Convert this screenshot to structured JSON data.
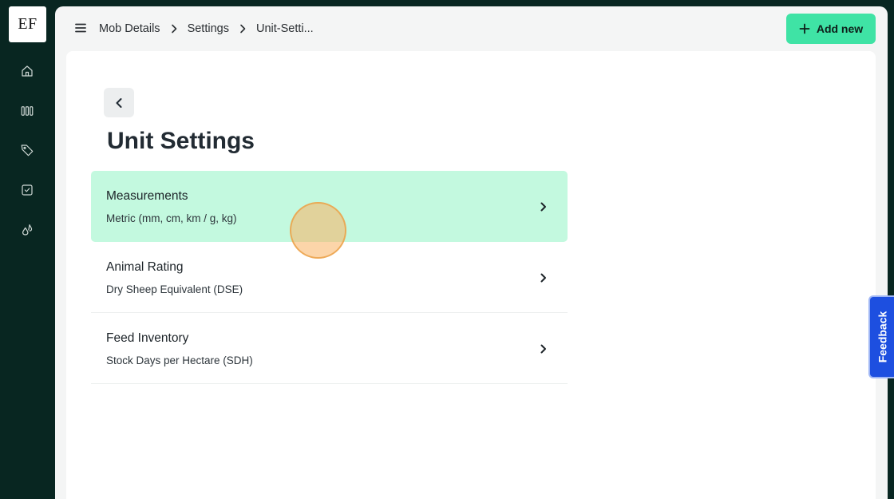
{
  "sidebar": {
    "logo_text": "EF",
    "items": [
      {
        "name": "home",
        "icon": "home-icon"
      },
      {
        "name": "paddocks",
        "icon": "columns-icon"
      },
      {
        "name": "tags",
        "icon": "tag-icon"
      },
      {
        "name": "tasks",
        "icon": "checkbox-icon"
      },
      {
        "name": "feed",
        "icon": "drops-icon"
      }
    ]
  },
  "header": {
    "breadcrumb": [
      "Mob Details",
      "Settings",
      "Unit-Setti..."
    ],
    "add_button_label": "Add new"
  },
  "page": {
    "title": "Unit Settings",
    "settings": [
      {
        "title": "Measurements",
        "value": "Metric (mm, cm, km / g, kg)",
        "active": true
      },
      {
        "title": "Animal Rating",
        "value": "Dry Sheep Equivalent (DSE)",
        "active": false
      },
      {
        "title": "Feed Inventory",
        "value": "Stock Days per Hectare (SDH)",
        "active": false
      }
    ]
  },
  "feedback": {
    "label": "Feedback"
  },
  "colors": {
    "sidebar_bg": "#082621",
    "accent": "#3fe3a5",
    "active_row": "#c3f9df",
    "feedback": "#1d4fe0"
  }
}
